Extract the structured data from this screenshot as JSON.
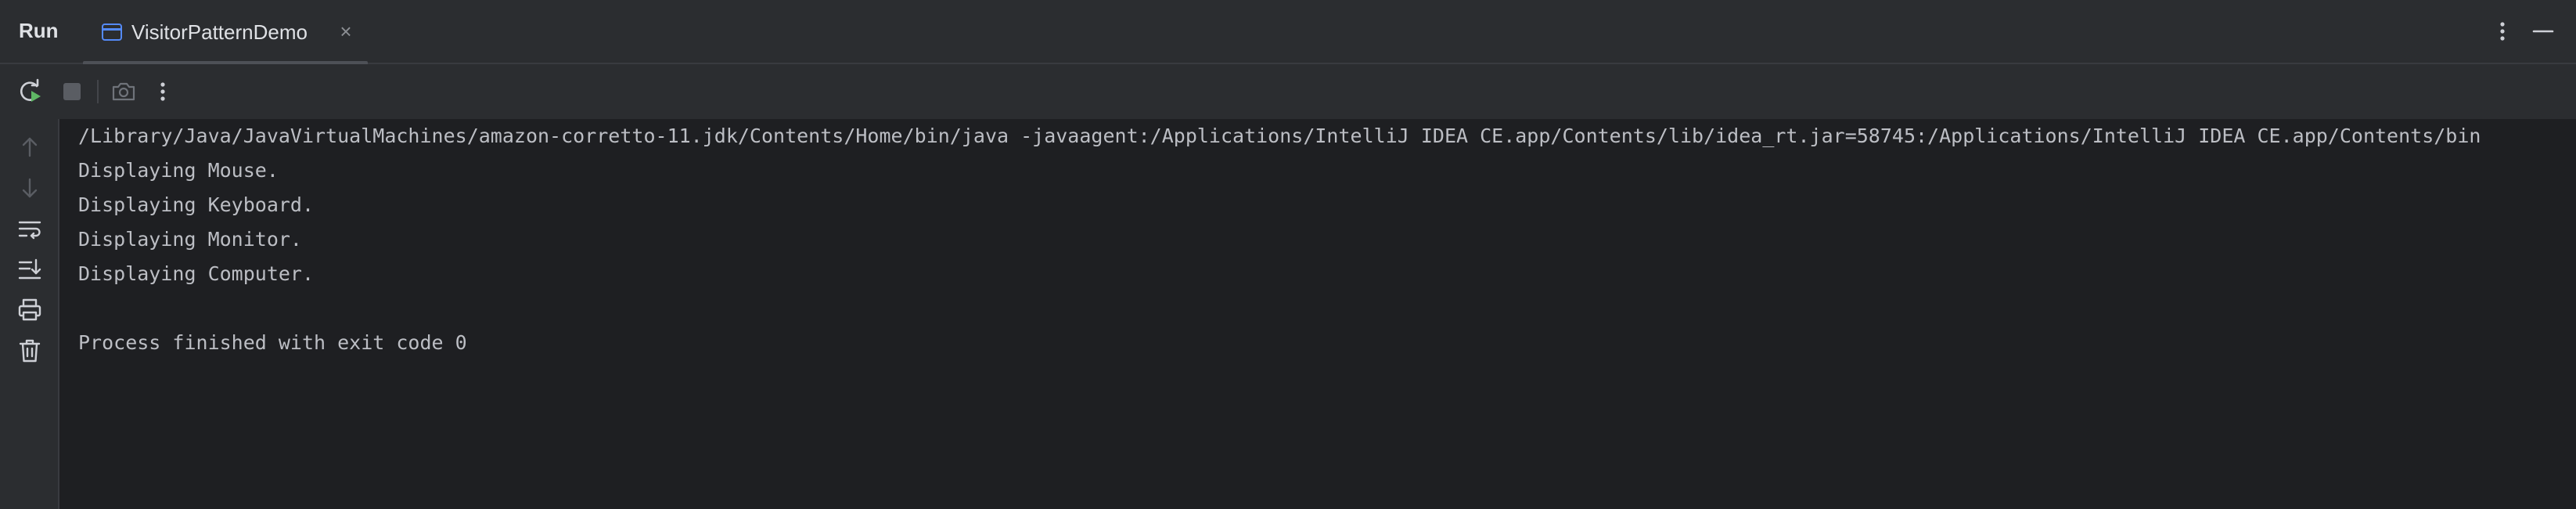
{
  "header": {
    "panel_title": "Run",
    "tab": {
      "label": "VisitorPatternDemo",
      "icon": "application-icon",
      "close_icon": "close-icon",
      "close_glyph": "×"
    },
    "actions": [
      "more-vertical-icon",
      "minimize-icon"
    ]
  },
  "toolbar": {
    "buttons": [
      "rerun-icon",
      "stop-icon",
      "camera-icon",
      "more-vertical-icon"
    ]
  },
  "gutter": {
    "buttons": [
      "arrow-up-icon",
      "arrow-down-icon",
      "soft-wrap-icon",
      "scroll-to-end-icon",
      "print-icon",
      "trash-icon"
    ]
  },
  "console": {
    "lines": [
      "/Library/Java/JavaVirtualMachines/amazon-corretto-11.jdk/Contents/Home/bin/java -javaagent:/Applications/IntelliJ IDEA CE.app/Contents/lib/idea_rt.jar=58745:/Applications/IntelliJ IDEA CE.app/Contents/bin",
      "Displaying Mouse.",
      "Displaying Keyboard.",
      "Displaying Monitor.",
      "Displaying Computer.",
      "",
      "Process finished with exit code 0"
    ]
  },
  "colors": {
    "panel_bg": "#2b2d30",
    "console_bg": "#1e1f22",
    "text": "#bcbec4",
    "accent_blue": "#548af7",
    "run_green": "#5fb865"
  }
}
